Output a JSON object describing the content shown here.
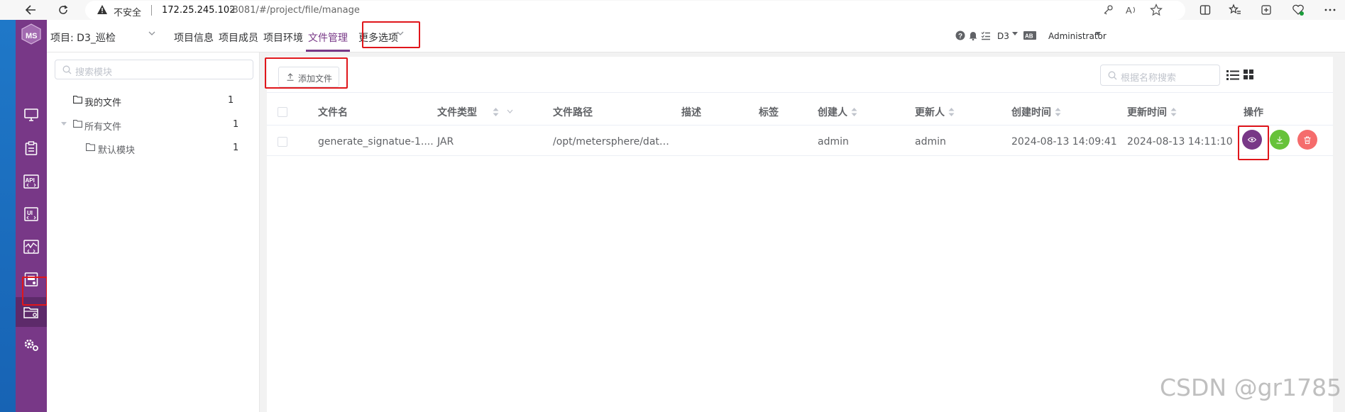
{
  "browser": {
    "insecure_label": "不安全",
    "url_host": "172.25.245.102",
    "url_rest": ":8081/#/project/file/manage"
  },
  "header": {
    "project_label": "项目: D3_巡检",
    "tabs": [
      {
        "label": "项目信息"
      },
      {
        "label": "项目成员"
      },
      {
        "label": "项目环境"
      },
      {
        "label": "文件管理",
        "active": true
      },
      {
        "label": "更多选项"
      }
    ],
    "workspace": "D3",
    "user": "Administrator"
  },
  "rail": {
    "items": [
      {
        "icon": "monitor-icon"
      },
      {
        "icon": "clipboard-icon"
      },
      {
        "icon": "api-icon",
        "text": "API"
      },
      {
        "icon": "ui-icon",
        "text": "UI"
      },
      {
        "icon": "performance-icon"
      },
      {
        "icon": "report-icon"
      },
      {
        "icon": "project-folder-icon",
        "active": true
      },
      {
        "icon": "settings-icon"
      }
    ]
  },
  "tree": {
    "search_placeholder": "搜索模块",
    "nodes": [
      {
        "label": "我的文件",
        "count": "1"
      },
      {
        "label": "所有文件",
        "count": "1"
      },
      {
        "label": "默认模块",
        "count": "1"
      }
    ]
  },
  "toolbar": {
    "add_file": "添加文件",
    "search_placeholder": "根据名称搜索"
  },
  "table": {
    "columns": [
      "文件名",
      "文件类型",
      "文件路径",
      "描述",
      "标签",
      "创建人",
      "更新人",
      "创建时间",
      "更新时间",
      "操作"
    ],
    "rows": [
      {
        "name": "generate_signatue-1....",
        "type": "JAR",
        "path": "/opt/metersphere/dat…",
        "description": "",
        "tags": "",
        "creator": "admin",
        "updater": "admin",
        "created": "2024-08-13 14:09:41",
        "updated": "2024-08-13 14:11:10"
      }
    ]
  },
  "colors": {
    "brand": "#783887",
    "success": "#67c23a",
    "danger": "#f56c6c",
    "highlight_box": "#e0161b"
  },
  "watermark": "CSDN @gr1785"
}
